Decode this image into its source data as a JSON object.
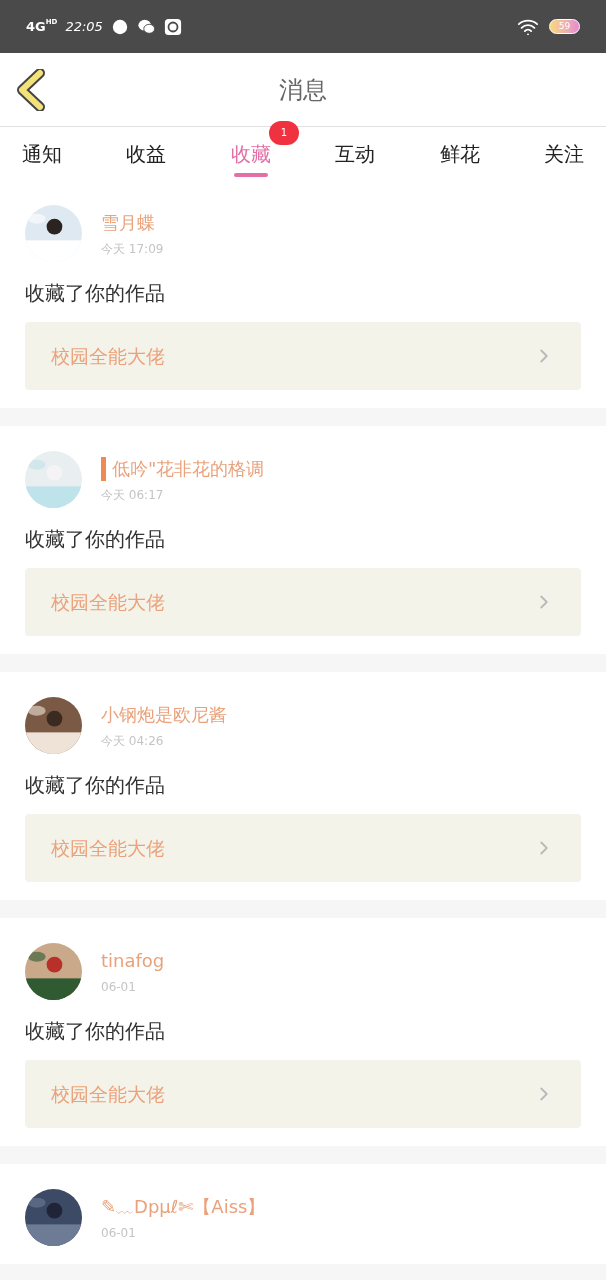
{
  "status_bar": {
    "network": "4G",
    "network_badge": "HD",
    "time": "22:05",
    "battery": "59"
  },
  "header": {
    "title": "消息"
  },
  "tabs": [
    {
      "label": "通知",
      "selected": false
    },
    {
      "label": "收益",
      "selected": false
    },
    {
      "label": "收藏",
      "selected": true,
      "badge": "1"
    },
    {
      "label": "互动",
      "selected": false
    },
    {
      "label": "鲜花",
      "selected": false
    },
    {
      "label": "关注",
      "selected": false
    }
  ],
  "messages": [
    {
      "name": "雪月蝶",
      "marker": false,
      "time": "今天 17:09",
      "text": "收藏了你的作品",
      "work": "校园全能大佬"
    },
    {
      "name": "低吟\"花非花的格调",
      "marker": true,
      "time": "今天 06:17",
      "text": "收藏了你的作品",
      "work": "校园全能大佬"
    },
    {
      "name": "小钢炮是欧尼酱",
      "marker": false,
      "time": "今天 04:26",
      "text": "收藏了你的作品",
      "work": "校园全能大佬"
    },
    {
      "name": "tinafog",
      "marker": false,
      "time": "06-01",
      "text": "收藏了你的作品",
      "work": "校园全能大佬"
    },
    {
      "name": "✎﹏Dpμℓ✄【Aiss】",
      "marker": false,
      "time": "06-01"
    }
  ]
}
